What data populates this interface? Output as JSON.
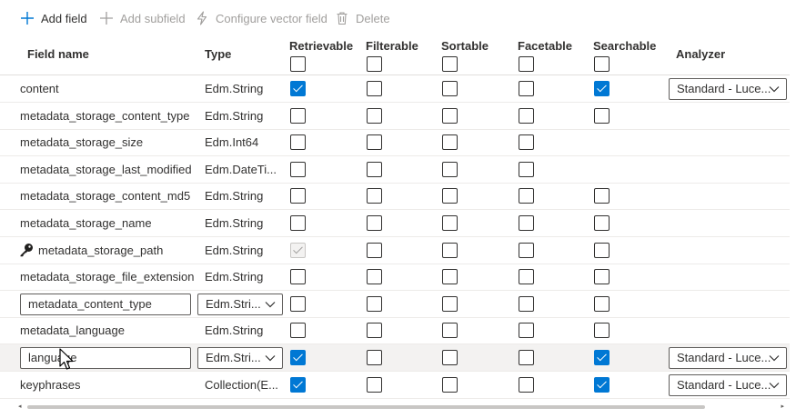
{
  "toolbar": {
    "add_field": "Add field",
    "add_subfield": "Add subfield",
    "configure_vector_field": "Configure vector field",
    "delete": "Delete"
  },
  "columns": {
    "field_name": "Field name",
    "type": "Type",
    "retrievable": "Retrievable",
    "filterable": "Filterable",
    "sortable": "Sortable",
    "facetable": "Facetable",
    "searchable": "Searchable",
    "analyzer": "Analyzer"
  },
  "rows": [
    {
      "name": "content",
      "type": "Edm.String",
      "retrievable": "checked",
      "filterable": "unchecked",
      "sortable": "unchecked",
      "facetable": "unchecked",
      "searchable": "checked",
      "analyzer": "Standard - Luce..."
    },
    {
      "name": "metadata_storage_content_type",
      "type": "Edm.String",
      "retrievable": "unchecked",
      "filterable": "unchecked",
      "sortable": "unchecked",
      "facetable": "unchecked",
      "searchable": "unchecked",
      "analyzer": ""
    },
    {
      "name": "metadata_storage_size",
      "type": "Edm.Int64",
      "retrievable": "unchecked",
      "filterable": "unchecked",
      "sortable": "unchecked",
      "facetable": "unchecked",
      "searchable": "none",
      "analyzer": ""
    },
    {
      "name": "metadata_storage_last_modified",
      "type": "Edm.DateTi...",
      "retrievable": "unchecked",
      "filterable": "unchecked",
      "sortable": "unchecked",
      "facetable": "unchecked",
      "searchable": "none",
      "analyzer": ""
    },
    {
      "name": "metadata_storage_content_md5",
      "type": "Edm.String",
      "retrievable": "unchecked",
      "filterable": "unchecked",
      "sortable": "unchecked",
      "facetable": "unchecked",
      "searchable": "unchecked",
      "analyzer": ""
    },
    {
      "name": "metadata_storage_name",
      "type": "Edm.String",
      "retrievable": "unchecked",
      "filterable": "unchecked",
      "sortable": "unchecked",
      "facetable": "unchecked",
      "searchable": "unchecked",
      "analyzer": ""
    },
    {
      "name": "metadata_storage_path",
      "type": "Edm.String",
      "key": true,
      "retrievable": "disabled-checked",
      "filterable": "unchecked",
      "sortable": "unchecked",
      "facetable": "unchecked",
      "searchable": "unchecked",
      "analyzer": ""
    },
    {
      "name": "metadata_storage_file_extension",
      "type": "Edm.String",
      "retrievable": "unchecked",
      "filterable": "unchecked",
      "sortable": "unchecked",
      "facetable": "unchecked",
      "searchable": "unchecked",
      "analyzer": ""
    },
    {
      "name": "metadata_content_type",
      "type": "Edm.Stri...",
      "editable": true,
      "retrievable": "unchecked",
      "filterable": "unchecked",
      "sortable": "unchecked",
      "facetable": "unchecked",
      "searchable": "unchecked",
      "analyzer": ""
    },
    {
      "name": "metadata_language",
      "type": "Edm.String",
      "retrievable": "unchecked",
      "filterable": "unchecked",
      "sortable": "unchecked",
      "facetable": "unchecked",
      "searchable": "unchecked",
      "analyzer": ""
    },
    {
      "name": "language",
      "type": "Edm.Stri...",
      "editable": true,
      "highlighted": true,
      "retrievable": "checked",
      "filterable": "unchecked",
      "sortable": "unchecked",
      "facetable": "unchecked",
      "searchable": "checked",
      "analyzer": "Standard - Luce..."
    },
    {
      "name": "keyphrases",
      "type": "Collection(E...",
      "retrievable": "checked",
      "filterable": "unchecked",
      "sortable": "unchecked",
      "facetable": "unchecked",
      "searchable": "checked",
      "analyzer": "Standard - Luce..."
    }
  ],
  "colors": {
    "accent": "#0078d4",
    "text": "#323130",
    "disabled_text": "#a19f9d",
    "row_highlight": "#f3f2f1"
  },
  "icons": {
    "add": "plus-icon",
    "add_subfield": "plus-icon",
    "vector": "lightning-icon",
    "delete": "trash-icon",
    "key": "key-icon",
    "dropdown": "chevron-down-icon",
    "cursor": "mouse-pointer-icon"
  }
}
